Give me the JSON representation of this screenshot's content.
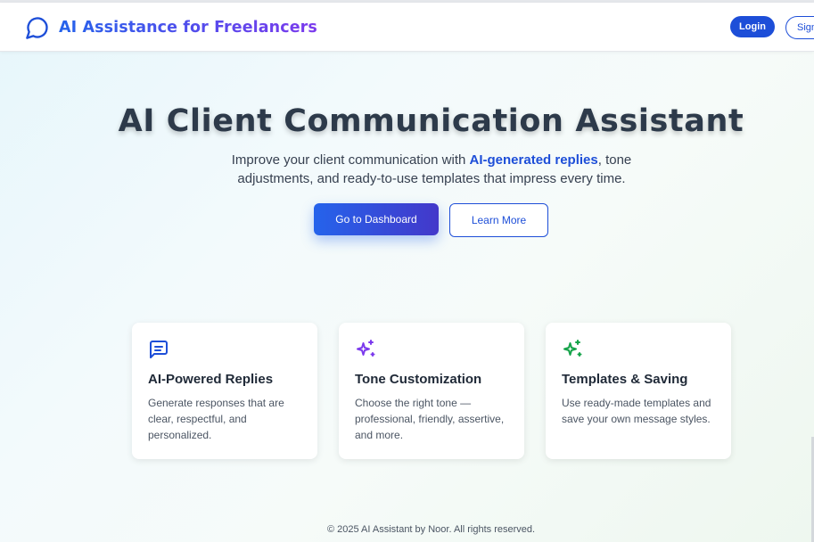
{
  "header": {
    "title": "AI Assistance for Freelancers",
    "login_label": "Login",
    "signup_label": "Sign Up"
  },
  "hero": {
    "title": "AI Client Communication Assistant",
    "subtitle_before": "Improve your client communication with ",
    "subtitle_highlight": "AI-generated replies",
    "subtitle_after": ", tone adjustments, and ready-to-use templates that impress every time.",
    "primary_label": "Go to Dashboard",
    "secondary_label": "Learn More"
  },
  "features": [
    {
      "icon": "message-square-icon",
      "title": "AI-Powered Replies",
      "text": "Generate responses that are clear, respectful, and personalized.",
      "color": "#1d4ed8"
    },
    {
      "icon": "sparkles-icon",
      "title": "Tone Customization",
      "text": "Choose the right tone — professional, friendly, assertive, and more.",
      "color": "#7c3aed"
    },
    {
      "icon": "sparkles-icon",
      "title": "Templates & Saving",
      "text": "Use ready-made templates and save your own message styles.",
      "color": "#16a34a"
    }
  ],
  "footer": {
    "text": "© 2025 AI Assistant by Noor. All rights reserved."
  }
}
